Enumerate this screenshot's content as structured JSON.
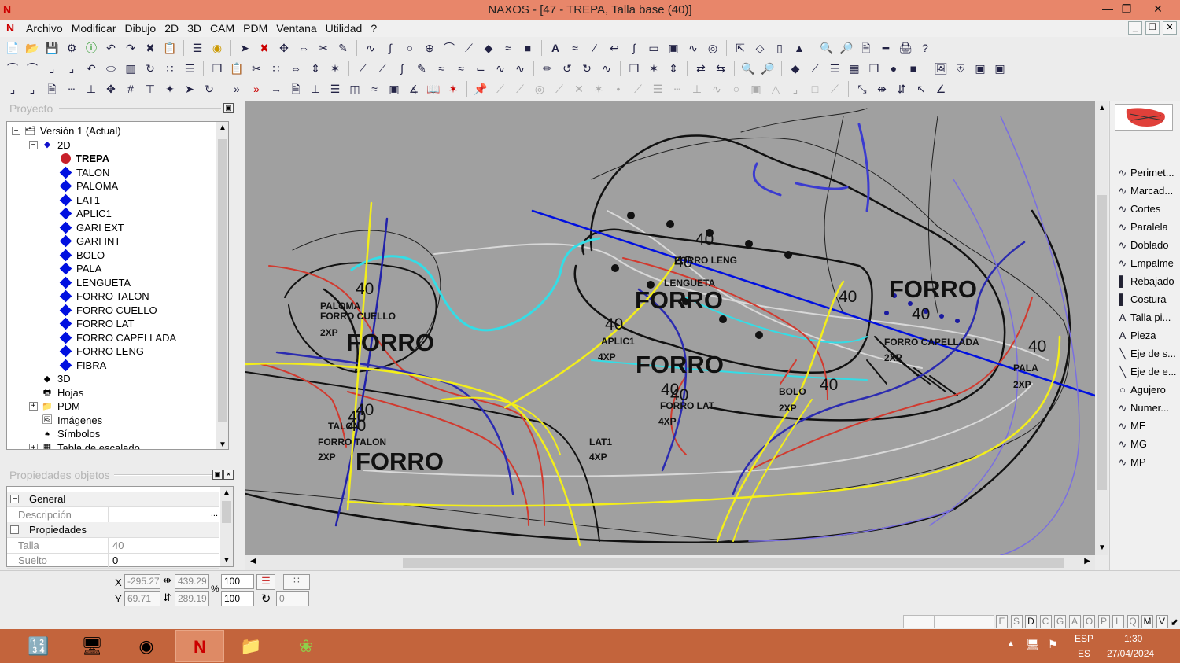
{
  "window": {
    "title": "NAXOS - [47 - TREPA, Talla base (40)]",
    "app_logo": "N"
  },
  "menu": {
    "items": [
      "Archivo",
      "Modificar",
      "Dibujo",
      "2D",
      "3D",
      "CAM",
      "PDM",
      "Ventana",
      "Utilidad",
      "?"
    ]
  },
  "project_panel": {
    "title": "Proyecto",
    "tree": [
      {
        "label": "Versión 1 (Actual)",
        "kind": "version-icon"
      },
      {
        "label": "2D",
        "kind": "folder-2d-icon"
      },
      {
        "label": "TREPA",
        "kind": "piece-active-icon",
        "bold": true
      },
      {
        "label": "TALON",
        "kind": "piece-icon"
      },
      {
        "label": "PALOMA",
        "kind": "piece-icon"
      },
      {
        "label": "LAT1",
        "kind": "piece-icon"
      },
      {
        "label": "APLIC1",
        "kind": "piece-icon"
      },
      {
        "label": "GARI EXT",
        "kind": "piece-icon"
      },
      {
        "label": "GARI INT",
        "kind": "piece-icon"
      },
      {
        "label": "BOLO",
        "kind": "piece-icon"
      },
      {
        "label": "PALA",
        "kind": "piece-icon"
      },
      {
        "label": "LENGUETA",
        "kind": "piece-icon"
      },
      {
        "label": "FORRO TALON",
        "kind": "piece-icon"
      },
      {
        "label": "FORRO CUELLO",
        "kind": "piece-icon"
      },
      {
        "label": "FORRO LAT",
        "kind": "piece-icon"
      },
      {
        "label": "FORRO CAPELLADA",
        "kind": "piece-icon"
      },
      {
        "label": "FORRO LENG",
        "kind": "piece-icon"
      },
      {
        "label": "FIBRA",
        "kind": "piece-icon"
      },
      {
        "label": "3D",
        "kind": "folder-3d-icon"
      },
      {
        "label": "Hojas",
        "kind": "sheets-icon"
      },
      {
        "label": "PDM",
        "kind": "folder-icon"
      },
      {
        "label": "Imágenes",
        "kind": "images-icon"
      },
      {
        "label": "Símbolos",
        "kind": "symbols-icon"
      },
      {
        "label": "Tabla de escalado",
        "kind": "table-icon"
      }
    ]
  },
  "properties_panel": {
    "title": "Propiedades objetos",
    "rows": [
      {
        "category": "General"
      },
      {
        "name": "Descripción",
        "value": ""
      },
      {
        "category": "Propiedades"
      },
      {
        "name": "Talla",
        "value": "40"
      },
      {
        "name": "Suelto",
        "value": "0"
      }
    ]
  },
  "canvas": {
    "labels": [
      {
        "text": "40",
        "cls": "num"
      },
      {
        "text": "FORRO",
        "cls": "big"
      },
      {
        "text": "FORRO",
        "cls": "big"
      },
      {
        "text": "FORRO",
        "cls": "big"
      },
      {
        "text": "FORRO",
        "cls": "big"
      },
      {
        "text": "FORRO",
        "cls": "big"
      },
      {
        "text": "PALOMA",
        "cls": "sm"
      },
      {
        "text": "FORRO CUELLO",
        "cls": "sm"
      },
      {
        "text": "2XP",
        "cls": "sm"
      },
      {
        "text": "40",
        "cls": "num"
      },
      {
        "text": "40",
        "cls": "num"
      },
      {
        "text": "TALON",
        "cls": "sm"
      },
      {
        "text": "FORRO TALON",
        "cls": "sm"
      },
      {
        "text": "2XP",
        "cls": "sm"
      },
      {
        "text": "40",
        "cls": "num"
      },
      {
        "text": "40",
        "cls": "num"
      },
      {
        "text": "APLIC1",
        "cls": "sm"
      },
      {
        "text": "4XP",
        "cls": "sm"
      },
      {
        "text": "LAT1",
        "cls": "sm"
      },
      {
        "text": "4XP",
        "cls": "sm"
      },
      {
        "text": "40",
        "cls": "num"
      },
      {
        "text": "FORRO LAT",
        "cls": "sm"
      },
      {
        "text": "4XP",
        "cls": "sm"
      },
      {
        "text": "40",
        "cls": "num"
      },
      {
        "text": "LENGUETA",
        "cls": "sm"
      },
      {
        "text": "FORRO LENG",
        "cls": "sm"
      },
      {
        "text": "40",
        "cls": "num"
      },
      {
        "text": "40",
        "cls": "num"
      },
      {
        "text": "BOLO",
        "cls": "sm"
      },
      {
        "text": "2XP",
        "cls": "sm"
      },
      {
        "text": "40",
        "cls": "num"
      },
      {
        "text": "40",
        "cls": "num"
      },
      {
        "text": "FORRO CAPELLADA",
        "cls": "sm"
      },
      {
        "text": "2XP",
        "cls": "sm"
      },
      {
        "text": "40",
        "cls": "num"
      },
      {
        "text": "PALA",
        "cls": "sm"
      },
      {
        "text": "2XP",
        "cls": "sm"
      },
      {
        "text": "40",
        "cls": "num"
      }
    ]
  },
  "right_panel": {
    "items": [
      {
        "label": "Perimet...",
        "icon": "perimeter-icon"
      },
      {
        "label": "Marcad...",
        "icon": "marker-icon"
      },
      {
        "label": "Cortes",
        "icon": "cuts-icon"
      },
      {
        "label": "Paralela",
        "icon": "parallel-icon"
      },
      {
        "label": "Doblado",
        "icon": "fold-icon"
      },
      {
        "label": "Empalme",
        "icon": "splice-icon"
      },
      {
        "label": "Rebajado",
        "icon": "skive-icon"
      },
      {
        "label": "Costura",
        "icon": "stitch-icon"
      },
      {
        "label": "Talla pi...",
        "icon": "size-text-icon"
      },
      {
        "label": "Pieza",
        "icon": "piece-text-icon"
      },
      {
        "label": "Eje de s...",
        "icon": "axis-icon"
      },
      {
        "label": "Eje de e...",
        "icon": "axis-icon"
      },
      {
        "label": "Agujero",
        "icon": "hole-icon"
      },
      {
        "label": "Numer...",
        "icon": "number-icon"
      },
      {
        "label": "ME",
        "icon": "me-icon"
      },
      {
        "label": "MG",
        "icon": "mg-icon"
      },
      {
        "label": "MP",
        "icon": "mp-icon"
      }
    ]
  },
  "status": {
    "x_label": "X",
    "y_label": "Y",
    "x_value": "-295.27",
    "y_value": "69.71",
    "width_value": "439.29",
    "height_value": "289.19",
    "pct_label": "%",
    "scale_x": "100",
    "scale_y": "100",
    "rotation": "0",
    "modes": [
      "E",
      "S",
      "D",
      "C",
      "G",
      "A",
      "O",
      "P",
      "L",
      "Q",
      "M",
      "V"
    ]
  },
  "taskbar": {
    "lang_top": "ESP",
    "lang_bottom": "ES",
    "time": "1:30",
    "date": "27/04/2024"
  }
}
